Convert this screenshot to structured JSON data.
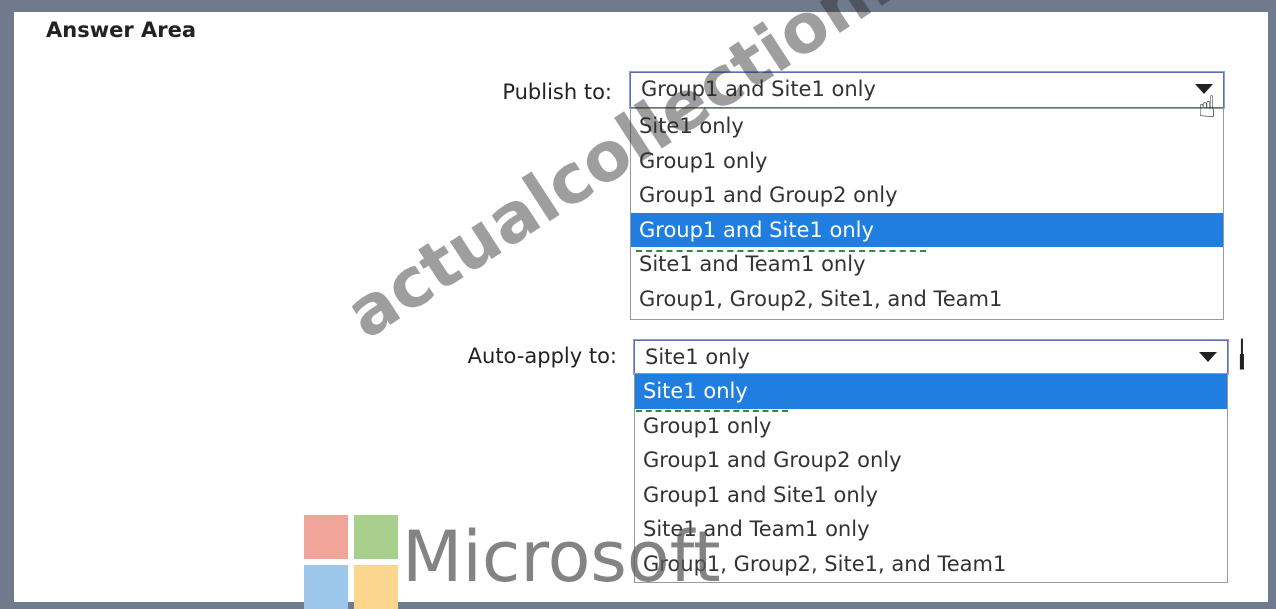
{
  "title": "Answer Area",
  "publish": {
    "label": "Publish to:",
    "value": "Group1 and Site1 only",
    "options": [
      "Site1 only",
      "Group1 only",
      "Group1 and Group2 only",
      "Group1 and Site1 only",
      "Site1 and Team1 only",
      "Group1, Group2, Site1, and Team1"
    ],
    "selected_index": 3
  },
  "autoapply": {
    "label": "Auto-apply to:",
    "value": "Site1 only",
    "options": [
      "Site1 only",
      "Group1 only",
      "Group1 and Group2 only",
      "Group1 and Site1 only",
      "Site1 and Team1 only",
      "Group1, Group2, Site1, and Team1"
    ],
    "selected_index": 0
  },
  "watermark": "actualcollection.com",
  "logo_text": "Microsoft",
  "colors": {
    "selection": "#1f7ee0",
    "ms_red": "#f1a59a",
    "ms_green": "#a8cf8c",
    "ms_blue": "#9cc7ea",
    "ms_yellow": "#fcd68f"
  }
}
